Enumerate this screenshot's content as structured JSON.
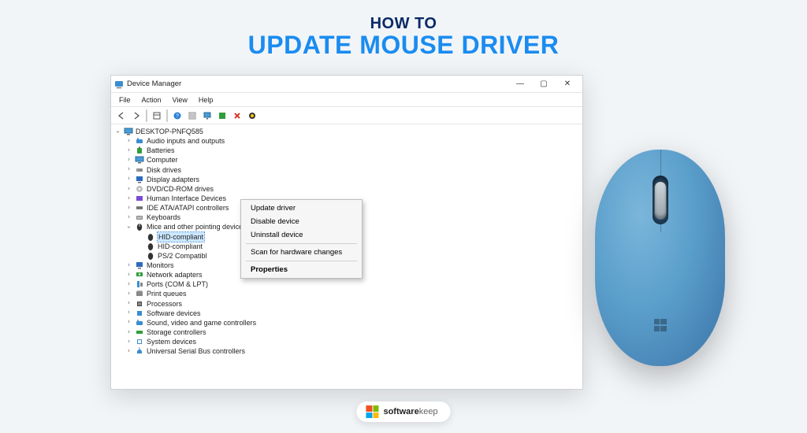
{
  "hero": {
    "line1": "HOW TO",
    "line2": "UPDATE MOUSE DRIVER"
  },
  "window": {
    "title": "Device Manager",
    "menus": {
      "file": "File",
      "action": "Action",
      "view": "View",
      "help": "Help"
    },
    "root": "DESKTOP-PNFQ585",
    "cats": [
      "Audio inputs and outputs",
      "Batteries",
      "Computer",
      "Disk drives",
      "Display adapters",
      "DVD/CD-ROM drives",
      "Human Interface Devices",
      "IDE ATA/ATAPI controllers",
      "Keyboards"
    ],
    "mice_label": "Mice and other pointing devices",
    "mice_children": [
      "HID-compliant",
      "HID-compliant",
      "PS/2 Compatibl"
    ],
    "cats2": [
      "Monitors",
      "Network adapters",
      "Ports (COM & LPT)",
      "Print queues",
      "Processors",
      "Software devices",
      "Sound, video and game controllers",
      "Storage controllers",
      "System devices",
      "Universal Serial Bus controllers"
    ]
  },
  "context_menu": {
    "update": "Update driver",
    "disable": "Disable device",
    "uninstall": "Uninstall device",
    "scan": "Scan for hardware changes",
    "properties": "Properties"
  },
  "brand": {
    "part1": "software",
    "part2": "keep"
  }
}
